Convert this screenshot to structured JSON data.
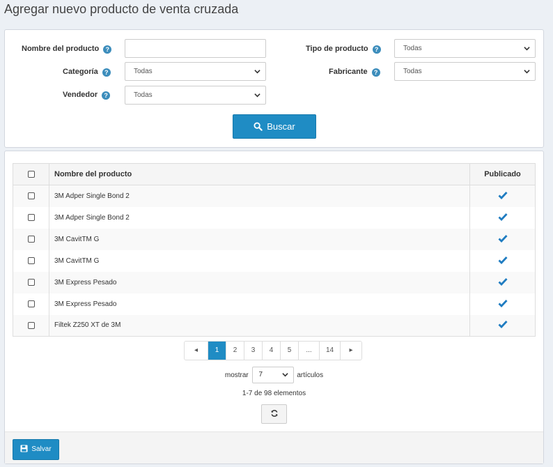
{
  "page": {
    "title": "Agregar nuevo producto de venta cruzada"
  },
  "filters": {
    "product_name": {
      "label": "Nombre del producto",
      "value": ""
    },
    "product_type": {
      "label": "Tipo de producto",
      "value": "Todas"
    },
    "category": {
      "label": "Categoría",
      "value": "Todas"
    },
    "manufacturer": {
      "label": "Fabricante",
      "value": "Todas"
    },
    "vendor": {
      "label": "Vendedor",
      "value": "Todas"
    },
    "help_glyph": "?",
    "search_label": "Buscar"
  },
  "grid": {
    "columns": {
      "name": "Nombre del producto",
      "published": "Publicado"
    },
    "rows": [
      {
        "name": "3M Adper Single Bond 2",
        "published": true
      },
      {
        "name": "3M Adper Single Bond 2",
        "published": true
      },
      {
        "name": "3M CavitTM G",
        "published": true
      },
      {
        "name": "3M CavitTM G",
        "published": true
      },
      {
        "name": "3M Express Pesado",
        "published": true
      },
      {
        "name": "3M Express Pesado",
        "published": true
      },
      {
        "name": "Filtek Z250 XT de 3M",
        "published": true
      }
    ],
    "pager": {
      "prev": "◂",
      "pages": [
        "1",
        "2",
        "3",
        "4",
        "5",
        "...",
        "14"
      ],
      "current": "1",
      "next": "▸"
    },
    "show_label": "mostrar",
    "page_size": "7",
    "items_label": "artículos",
    "summary": "1-7 de 98 elementos"
  },
  "footer": {
    "save_label": "Salvar"
  },
  "colors": {
    "accent": "#1f8cc4",
    "check": "#1f7cc1"
  },
  "icons": {
    "help": "question-circle-icon",
    "search": "search-icon",
    "chevron": "chevron-down-icon",
    "check": "check-icon",
    "refresh": "refresh-icon",
    "save": "floppy-disk-icon"
  }
}
